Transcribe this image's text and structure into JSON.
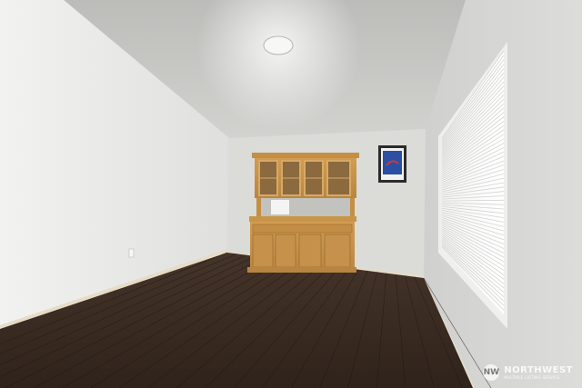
{
  "scene": {
    "description_colors": {
      "ceiling": "#c9c9c6",
      "left_wall": "#e9e9e7",
      "back_wall": "#dcdcd9",
      "right_wall": "#d6d6d4",
      "floor_dark": "#2e221a",
      "floor_mid": "#4a3729",
      "hutch_wood": "#c9964a",
      "baseboard": "#e8ddc9"
    }
  },
  "watermark": {
    "badge": "NW",
    "name": "NORTHWEST",
    "sub": "MULTIPLE LISTING SERVICE"
  }
}
